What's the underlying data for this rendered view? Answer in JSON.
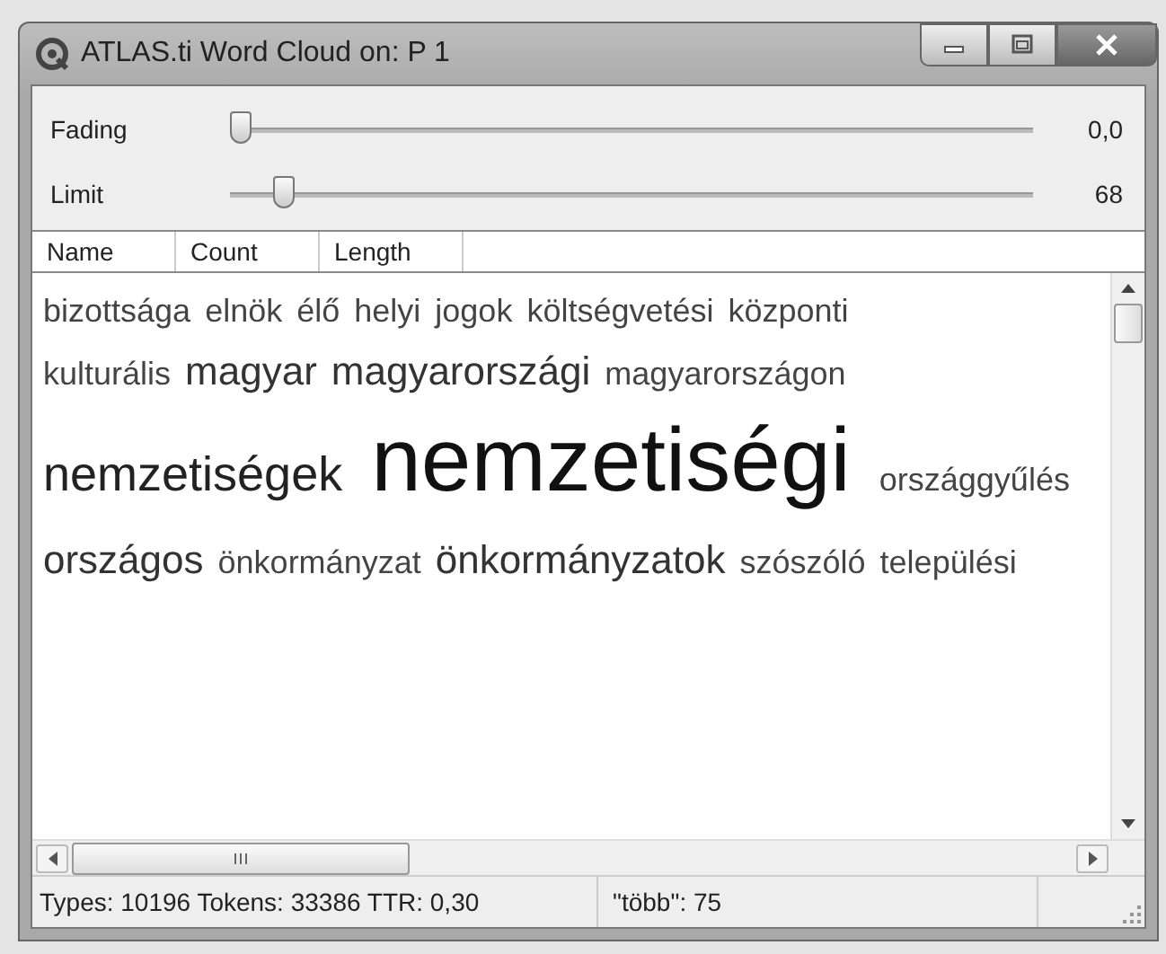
{
  "window": {
    "title": "ATLAS.ti Word Cloud on: P 1"
  },
  "sliders": [
    {
      "label": "Fading",
      "level": 0,
      "reading": "0,0"
    },
    {
      "label": "Limit",
      "level": 0.055,
      "reading": "68"
    }
  ],
  "columns": [
    {
      "label": "Name"
    },
    {
      "label": "Count"
    },
    {
      "label": "Length"
    }
  ],
  "cloud": {
    "lines": [
      {
        "words": [
          {
            "text": "bizottsága",
            "kind": "small"
          },
          {
            "text": "elnök",
            "kind": "small"
          },
          {
            "text": "élő",
            "kind": "small"
          },
          {
            "text": "helyi",
            "kind": "small"
          },
          {
            "text": "jogok",
            "kind": "small"
          },
          {
            "text": "költségvetési",
            "kind": "small"
          },
          {
            "text": "központi",
            "kind": "small"
          }
        ]
      },
      {
        "words": [
          {
            "text": "kulturális",
            "kind": "small"
          },
          {
            "text": "magyar",
            "kind": "medium"
          },
          {
            "text": "magyarországi",
            "kind": "medium"
          },
          {
            "text": "magyarországon",
            "kind": "small"
          }
        ]
      },
      {
        "words": [
          {
            "text": "nemzetiségek",
            "kind": "large"
          },
          {
            "text": "nemzetiségi",
            "kind": "huge"
          },
          {
            "text": "országgyűlés",
            "kind": "small"
          }
        ]
      },
      {
        "words": [
          {
            "text": "országos",
            "kind": "medium"
          },
          {
            "text": "önkormányzat",
            "kind": "small"
          },
          {
            "text": "önkormányzatok",
            "kind": "medium"
          },
          {
            "text": "szószóló",
            "kind": "small"
          },
          {
            "text": "települési",
            "kind": "small"
          }
        ]
      }
    ]
  },
  "status_bar": [
    "Types: 10196  Tokens: 33386  TTR: 0,30",
    "\"több\": 75"
  ]
}
